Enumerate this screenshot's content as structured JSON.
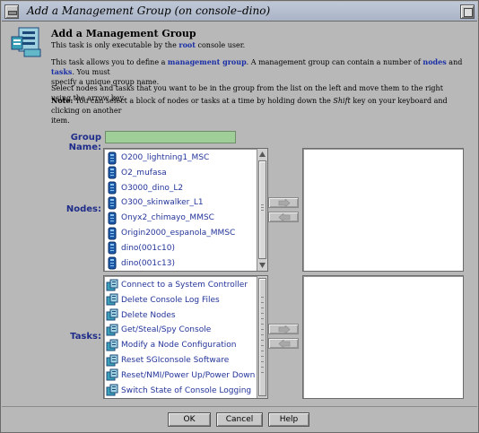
{
  "window": {
    "title": "Add a Management Group (on console–dino)"
  },
  "header": {
    "heading": "Add a Management Group",
    "p1": {
      "a": "This task is only executable by the ",
      "b": "root",
      "c": " console user."
    },
    "p2": {
      "a": "This task allows you to define a ",
      "link1": "management group",
      "b": ". A management group can contain a number of ",
      "link2": "nodes",
      "c": " and ",
      "link3": "tasks",
      "d": ". You must",
      "e": "specify a unique group name."
    },
    "p3": "Select nodes and tasks that you want to be in the group from the list on the left and move them to the right using the arrow key.",
    "p4": {
      "note": "Note:",
      "a": " You can select a block of nodes or tasks at a time by holding down the ",
      "shift": "Shift",
      "b": " key on your keyboard and clicking on another",
      "c": "item."
    }
  },
  "form": {
    "group_name_label": "Group Name:",
    "group_name_value": "",
    "group_name_color": "#9fce98",
    "nodes_label": "Nodes:",
    "tasks_label": "Tasks:"
  },
  "nodes": [
    "O200_lightning1_MSC",
    "O2_mufasa",
    "O3000_dino_L2",
    "O300_skinwalker_L1",
    "Onyx2_chimayo_MMSC",
    "Origin2000_espanola_MMSC",
    "dino(001c10)",
    "dino(001c13)"
  ],
  "tasks": [
    "Connect to a System Controller",
    "Delete Console Log Files",
    "Delete Nodes",
    "Get/Steal/Spy Console",
    "Modify a Node Configuration",
    "Reset SGIconsole Software",
    "Reset/NMI/Power Up/Power Down",
    "Switch State of Console Logging"
  ],
  "buttons": {
    "ok": "OK",
    "cancel": "Cancel",
    "help": "Help"
  },
  "colors": {
    "link": "#1a2fa6",
    "label": "#1f2d8a",
    "list_text": "#23349a"
  }
}
